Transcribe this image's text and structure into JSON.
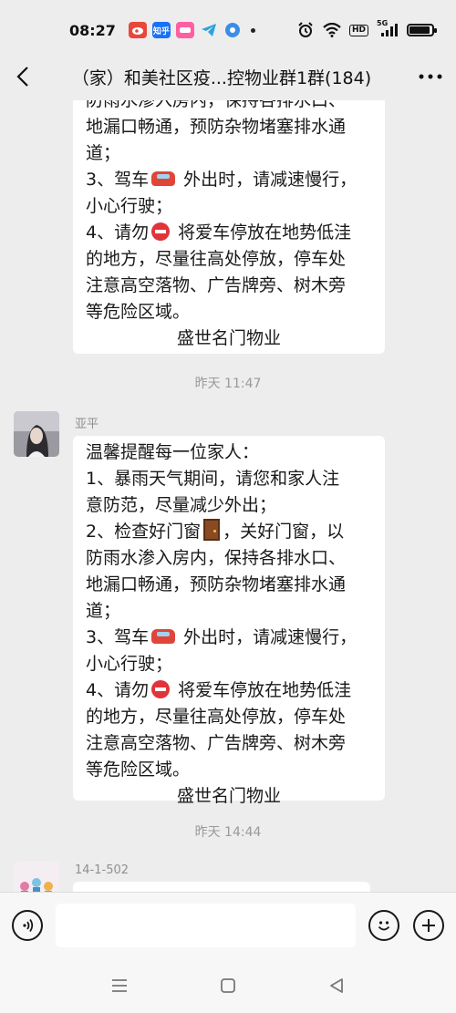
{
  "status_bar": {
    "time": "08:27",
    "apps": [
      {
        "icon": "weibo-app-icon",
        "label": "",
        "color": "#e8473c"
      },
      {
        "icon": "zhihu-app-icon",
        "label": "知乎",
        "color": "#1772f6"
      },
      {
        "icon": "meiyou-app-icon",
        "label": "",
        "color": "#ff5fa2"
      },
      {
        "icon": "telegram-app-icon",
        "label": "",
        "color": "#2ba3df"
      },
      {
        "icon": "browser-app-icon",
        "label": "",
        "color": "#3a8ee6"
      }
    ],
    "hd_label": "HD",
    "network_label": "5G",
    "battery_level": 0.9
  },
  "header": {
    "title": "（家）和美社区疫...控物业群1群(184)",
    "back_icon": "back-chevron-icon",
    "more_label": "···"
  },
  "messages": {
    "first_partial": {
      "lines": [
        "防雨水渗入房内，保持各排水口、",
        "地漏口畅通，预防杂物堵塞排水通",
        "道；",
        "3、驾车",
        " 外出时，请减速慢行，",
        "小心行驶；",
        "4、请勿",
        " 将爱车停放在地势低洼",
        "的地方，尽量往高处停放，停车处",
        "注意高空落物、广告牌旁、树木旁",
        "等危险区域。"
      ],
      "signature": "盛世名门物业"
    },
    "time_1": "昨天 11:47",
    "second": {
      "sender": "亚平",
      "lines": [
        "温馨提醒每一位家人：",
        "1、暴雨天气期间，请您和家人注",
        "意防范，尽量减少外出；",
        "2、检查好门窗",
        "，关好门窗，以",
        "防雨水渗入房内，保持各排水口、",
        "地漏口畅通，预防杂物堵塞排水通",
        "道；",
        "3、驾车",
        " 外出时，请减速慢行，",
        "小心行驶；",
        "4、请勿",
        " 将爱车停放在地势低洼",
        "的地方，尽量往高处停放，停车处",
        "注意高空落物、广告牌旁、树木旁",
        "等危险区域。"
      ],
      "signature": "盛世名门物业"
    },
    "time_2": "昨天 14:44",
    "third": {
      "sender": "14-1-502"
    }
  },
  "input_bar": {
    "placeholder": ""
  },
  "colors": {
    "background": "#ededed",
    "bubble": "#ffffff",
    "timestamp": "#9a9a9a"
  }
}
